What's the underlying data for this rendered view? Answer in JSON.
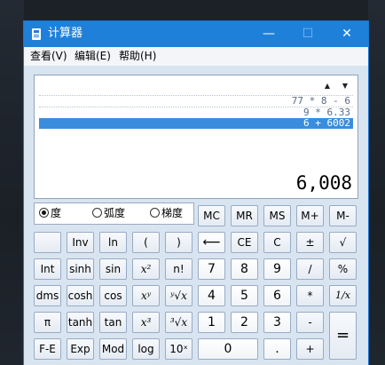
{
  "window": {
    "title": "计算器",
    "min_icon": "minimize-icon",
    "max_icon": "maximize-icon",
    "close_icon": "close-icon",
    "min_glyph": "—",
    "max_glyph": "☐",
    "close_glyph": "✕"
  },
  "menu": [
    "查看(V)",
    "编辑(E)",
    "帮助(H)"
  ],
  "display": {
    "history": [
      "77 * 8 - 6",
      "9 * 6.33",
      "6 + 6002"
    ],
    "selected_index": 2,
    "result": "6,008",
    "scroll_up": "▲",
    "scroll_down": "▼"
  },
  "angle_modes": [
    {
      "label": "度",
      "selected": true
    },
    {
      "label": "弧度",
      "selected": false
    },
    {
      "label": "梯度",
      "selected": false
    }
  ],
  "memory": [
    "MC",
    "MR",
    "MS",
    "M+",
    "M-"
  ],
  "rows": [
    [
      "",
      "Inv",
      "ln",
      "(",
      ")",
      "⟵",
      "CE",
      "C",
      "±",
      "√"
    ],
    [
      "Int",
      "sinh",
      "sin",
      "x²",
      "n!",
      "7",
      "8",
      "9",
      "/",
      "%"
    ],
    [
      "dms",
      "cosh",
      "cos",
      "xʸ",
      "ʸ√x",
      "4",
      "5",
      "6",
      "*",
      "1/x"
    ],
    [
      "π",
      "tanh",
      "tan",
      "x³",
      "³√x",
      "1",
      "2",
      "3",
      "-",
      "="
    ],
    [
      "F-E",
      "Exp",
      "Mod",
      "log",
      "10ˣ",
      "0",
      ".",
      "+"
    ]
  ]
}
